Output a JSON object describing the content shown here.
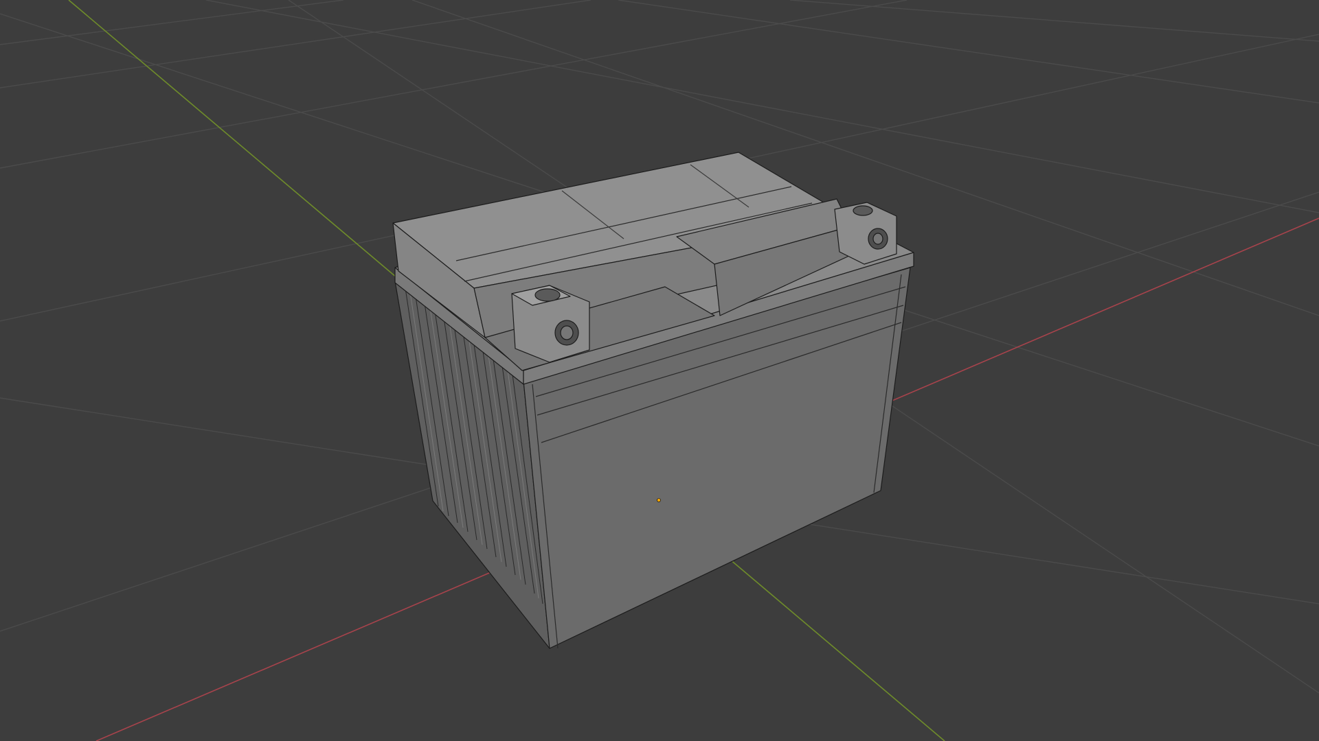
{
  "viewport": {
    "background_color": "#3d3d3d",
    "grid_color": "#4a4a4a",
    "axis_x_color": "#b4454e",
    "axis_y_color": "#7c9a2c",
    "origin_marker_color": "#ffaa00"
  },
  "object": {
    "type": "battery-mesh",
    "shading": "solid-with-wireframe",
    "base_color": "#6a6a6a",
    "top_color": "#8c8c8c",
    "side_color": "#747474",
    "edge_color": "#1a1a1a"
  }
}
